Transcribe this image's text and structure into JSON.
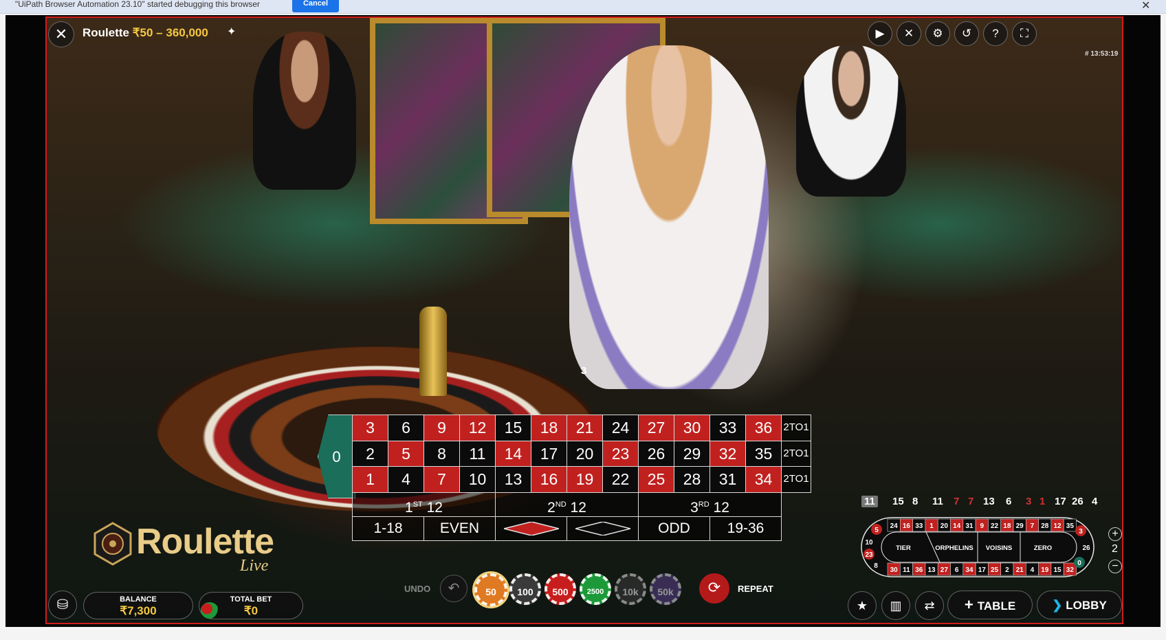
{
  "infobar": {
    "message": "\"UiPath Browser Automation 23.10\" started debugging this browser",
    "cancel_label": "Cancel",
    "close_symbol": "✕"
  },
  "header": {
    "close_symbol": "✕",
    "game_name": "Roulette",
    "limits": "₹50 – 360,000",
    "round_id": "# 13:53:19",
    "controls": [
      {
        "name": "video-icon",
        "glyph": "▶"
      },
      {
        "name": "mute-icon",
        "glyph": "✕"
      },
      {
        "name": "settings-icon",
        "glyph": "⚙"
      },
      {
        "name": "history-icon",
        "glyph": "↺"
      },
      {
        "name": "help-icon",
        "glyph": "?"
      },
      {
        "name": "fullscreen-icon",
        "glyph": "⛶"
      }
    ]
  },
  "last_win": "3",
  "board": {
    "zero": "0",
    "rows": [
      [
        [
          "3",
          "red"
        ],
        [
          "6",
          "black"
        ],
        [
          "9",
          "red"
        ],
        [
          "12",
          "red"
        ],
        [
          "15",
          "black"
        ],
        [
          "18",
          "red"
        ],
        [
          "21",
          "red"
        ],
        [
          "24",
          "black"
        ],
        [
          "27",
          "red"
        ],
        [
          "30",
          "red"
        ],
        [
          "33",
          "black"
        ],
        [
          "36",
          "red"
        ]
      ],
      [
        [
          "2",
          "black"
        ],
        [
          "5",
          "red"
        ],
        [
          "8",
          "black"
        ],
        [
          "11",
          "black"
        ],
        [
          "14",
          "red"
        ],
        [
          "17",
          "black"
        ],
        [
          "20",
          "black"
        ],
        [
          "23",
          "red"
        ],
        [
          "26",
          "black"
        ],
        [
          "29",
          "black"
        ],
        [
          "32",
          "red"
        ],
        [
          "35",
          "black"
        ]
      ],
      [
        [
          "1",
          "red"
        ],
        [
          "4",
          "black"
        ],
        [
          "7",
          "red"
        ],
        [
          "10",
          "black"
        ],
        [
          "13",
          "black"
        ],
        [
          "16",
          "red"
        ],
        [
          "19",
          "red"
        ],
        [
          "22",
          "black"
        ],
        [
          "25",
          "red"
        ],
        [
          "28",
          "black"
        ],
        [
          "31",
          "black"
        ],
        [
          "34",
          "red"
        ]
      ]
    ],
    "column_bet": "2TO1",
    "dozens": [
      {
        "main": "1",
        "sup": "ST",
        "rest": " 12"
      },
      {
        "main": "2",
        "sup": "ND",
        "rest": " 12"
      },
      {
        "main": "3",
        "sup": "RD",
        "rest": " 12"
      }
    ],
    "even_money": [
      "1-18",
      "EVEN",
      "",
      "",
      "ODD",
      "19-36"
    ],
    "colors": {
      "red": "#c0211f",
      "black": "#0b0b0b",
      "zero": "#1a6e5a"
    }
  },
  "logo": {
    "word": "Roulette",
    "sub": "Live"
  },
  "wallet": {
    "balance_label": "BALANCE",
    "balance_value": "₹7,300",
    "total_bet_label": "TOTAL BET",
    "total_bet_value": "₹0"
  },
  "bet_controls": {
    "undo_label": "UNDO",
    "repeat_label": "REPEAT",
    "chips": [
      {
        "value": "50",
        "color": "#e07a22",
        "selected": true
      },
      {
        "value": "100",
        "color": "#3a3a3a",
        "selected": false
      },
      {
        "value": "500",
        "color": "#c81d1d",
        "selected": false
      },
      {
        "value": "2500",
        "color": "#1c9a3a",
        "selected": false
      },
      {
        "value": "10k",
        "color": "#3a3a3a",
        "selected": false
      },
      {
        "value": "50k",
        "color": "#5a3f8a",
        "selected": false
      }
    ]
  },
  "history": [
    {
      "n": "11",
      "c": "w",
      "first": true
    },
    {
      "n": "15",
      "c": "w"
    },
    {
      "n": "8",
      "c": "w"
    },
    {
      "n": "11",
      "c": "w"
    },
    {
      "n": "7",
      "c": "r"
    },
    {
      "n": "7",
      "c": "r"
    },
    {
      "n": "13",
      "c": "w"
    },
    {
      "n": "6",
      "c": "w"
    },
    {
      "n": "3",
      "c": "r"
    },
    {
      "n": "1",
      "c": "r"
    },
    {
      "n": "17",
      "c": "w"
    },
    {
      "n": "26",
      "c": "w"
    },
    {
      "n": "4",
      "c": "w"
    }
  ],
  "racetrack": {
    "top_row": [
      "24",
      "16",
      "33",
      "1",
      "20",
      "14",
      "31",
      "9",
      "22",
      "18",
      "29",
      "7",
      "28",
      "12",
      "35"
    ],
    "bottom_row": [
      "30",
      "11",
      "36",
      "13",
      "27",
      "6",
      "34",
      "17",
      "25",
      "2",
      "21",
      "4",
      "19",
      "15",
      "32"
    ],
    "left_end": [
      "5",
      "10",
      "23",
      "8"
    ],
    "right_end": [
      "3",
      "26",
      "0"
    ],
    "sections": [
      "TIER",
      "ORPHELINS",
      "VOISINS",
      "ZERO"
    ],
    "zoom": "2"
  },
  "footer_buttons": {
    "table_label": "TABLE",
    "lobby_label": "LOBBY"
  }
}
